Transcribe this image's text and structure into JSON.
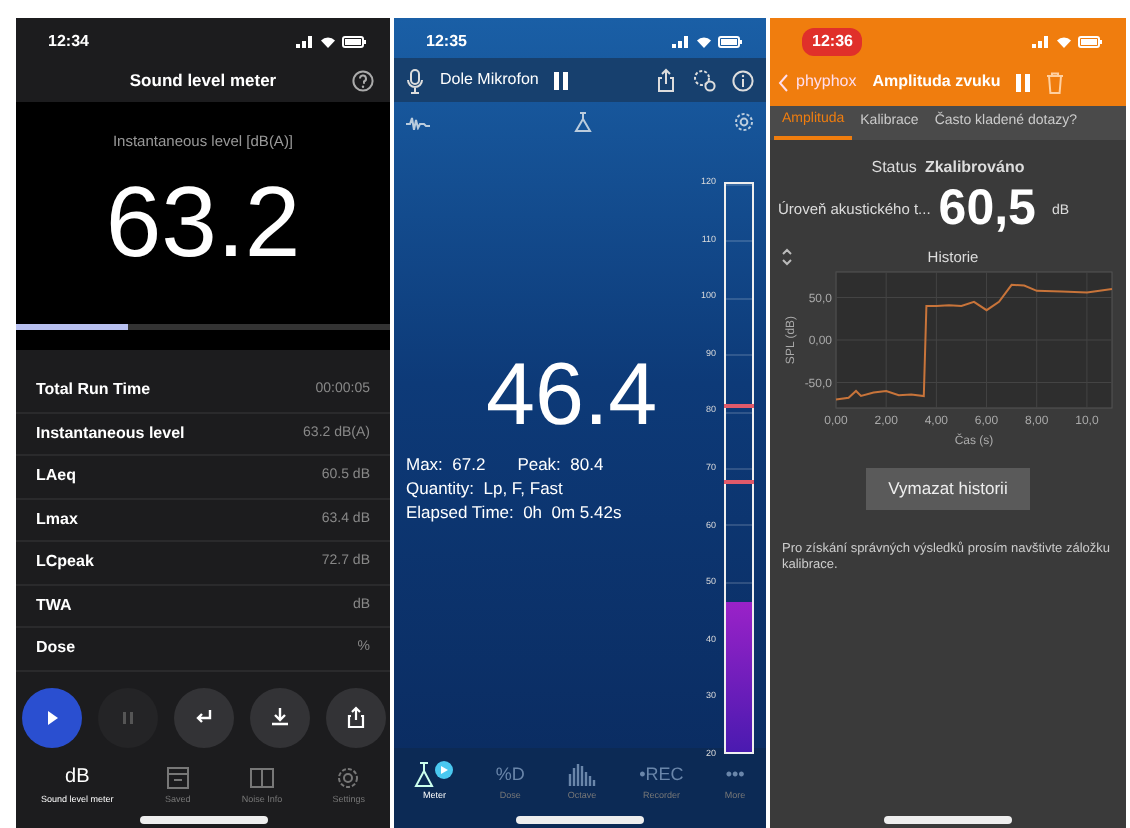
{
  "sound_level_meter": {
    "status_time": "12:34",
    "title": "Sound level meter",
    "reading_label": "Instantaneous level [dB(A)]",
    "reading": "63.2",
    "progress": {
      "level": 0.3
    },
    "rows": [
      {
        "label": "Total Run Time",
        "value": "00:00:05"
      },
      {
        "label": "Instantaneous level",
        "value": "63.2 dB(A)"
      },
      {
        "label": "LAeq",
        "value": "60.5 dB"
      },
      {
        "label": "Lmax",
        "value": "63.4 dB"
      },
      {
        "label": "LCpeak",
        "value": "72.7 dB"
      },
      {
        "label": "TWA",
        "value": "dB"
      },
      {
        "label": "Dose",
        "value": "%"
      }
    ],
    "controls": [
      {
        "kind": "play",
        "disabled": false
      },
      {
        "kind": "pause",
        "disabled": true
      },
      {
        "kind": "return",
        "disabled": false
      },
      {
        "kind": "download",
        "disabled": false
      },
      {
        "kind": "share",
        "disabled": false
      }
    ],
    "tabs": [
      {
        "kind": "text",
        "icon_text": "dB",
        "label": "Sound level meter",
        "selected": true
      },
      {
        "kind": "archive",
        "label": "Saved",
        "selected": false
      },
      {
        "kind": "book",
        "label": "Noise Info",
        "selected": false
      },
      {
        "kind": "gear",
        "label": "Settings",
        "selected": false
      }
    ]
  },
  "decibel_meter": {
    "status_time": "12:35",
    "source": "Dole Mikrofon",
    "reading": "46.4",
    "lines": [
      {
        "items": [
          {
            "label": "Max:",
            "value": "67.2"
          },
          {
            "label": "Peak:",
            "value": "80.4"
          }
        ]
      },
      {
        "items": [
          {
            "label": "Quantity:",
            "value": "Lp, F, Fast"
          }
        ]
      },
      {
        "items": [
          {
            "label": "Elapsed Time:",
            "value": "0h  0m 5.42s"
          }
        ]
      }
    ],
    "scale_ticks": [
      "120",
      "110",
      "100",
      "90",
      "80",
      "70",
      "60",
      "50",
      "40",
      "30",
      "20"
    ],
    "level": 0.264,
    "markers": [
      {
        "level": 0.604
      },
      {
        "level": 0.472
      }
    ],
    "tabs": [
      {
        "kind": "flask",
        "label": "Meter",
        "selected": true
      },
      {
        "kind": "text",
        "icon_text": "%D",
        "label": "Dose",
        "selected": false
      },
      {
        "kind": "bars",
        "label": "Octave",
        "selected": false
      },
      {
        "kind": "text",
        "icon_text": "•REC",
        "label": "Recorder",
        "selected": false
      },
      {
        "kind": "text",
        "icon_text": "•••",
        "label": "More",
        "selected": false
      }
    ]
  },
  "phyphox": {
    "status_time": "12:36",
    "back": "phyphox",
    "title": "Amplituda zvuku",
    "tabs": [
      {
        "label": "Amplituda",
        "selected": true
      },
      {
        "label": "Kalibrace",
        "selected": false
      },
      {
        "label": "Často kladené dotazy?",
        "selected": false
      }
    ],
    "status_label": "Status",
    "status_value": "Zkalibrováno",
    "level_label": "Úroveň akustického t...",
    "level_value": "60,5",
    "level_unit": "dB",
    "history": {
      "chart_data": {
        "type": "line",
        "title": "Historie",
        "xlabel": "Čas (s)",
        "ylabel": "SPL (dB)",
        "x": [
          0,
          0.5,
          0.8,
          1,
          1.5,
          2,
          2.5,
          3,
          3.5,
          3.6,
          4,
          4.5,
          5,
          5.5,
          6,
          6.5,
          7,
          7.5,
          8,
          9,
          10,
          11
        ],
        "grid": true,
        "series": [
          {
            "color": "#c8743a",
            "values": [
              -70,
              -68,
              -60,
              -66,
              -62,
              -60,
              -65,
              -64,
              -66,
              40,
              40,
              41,
              40,
              45,
              35,
              45,
              65,
              64,
              58,
              57,
              56,
              60
            ]
          }
        ],
        "xlim": [
          0,
          11
        ],
        "ylim": [
          -80,
          80
        ],
        "xticks": [
          {
            "value": 0,
            "label": "0,00"
          },
          {
            "value": 2,
            "label": "2,00"
          },
          {
            "value": 4,
            "label": "4,00"
          },
          {
            "value": 6,
            "label": "6,00"
          },
          {
            "value": 8,
            "label": "8,00"
          },
          {
            "value": 10,
            "label": "10,0"
          }
        ],
        "yticks": [
          {
            "value": 50,
            "label": "50,0"
          },
          {
            "value": 0,
            "label": "0,00"
          },
          {
            "value": -50,
            "label": "-50,0"
          }
        ]
      }
    },
    "clear_button": "Vymazat historii",
    "note": "Pro získání správných výsledků prosím navštivte záložku kalibrace."
  }
}
